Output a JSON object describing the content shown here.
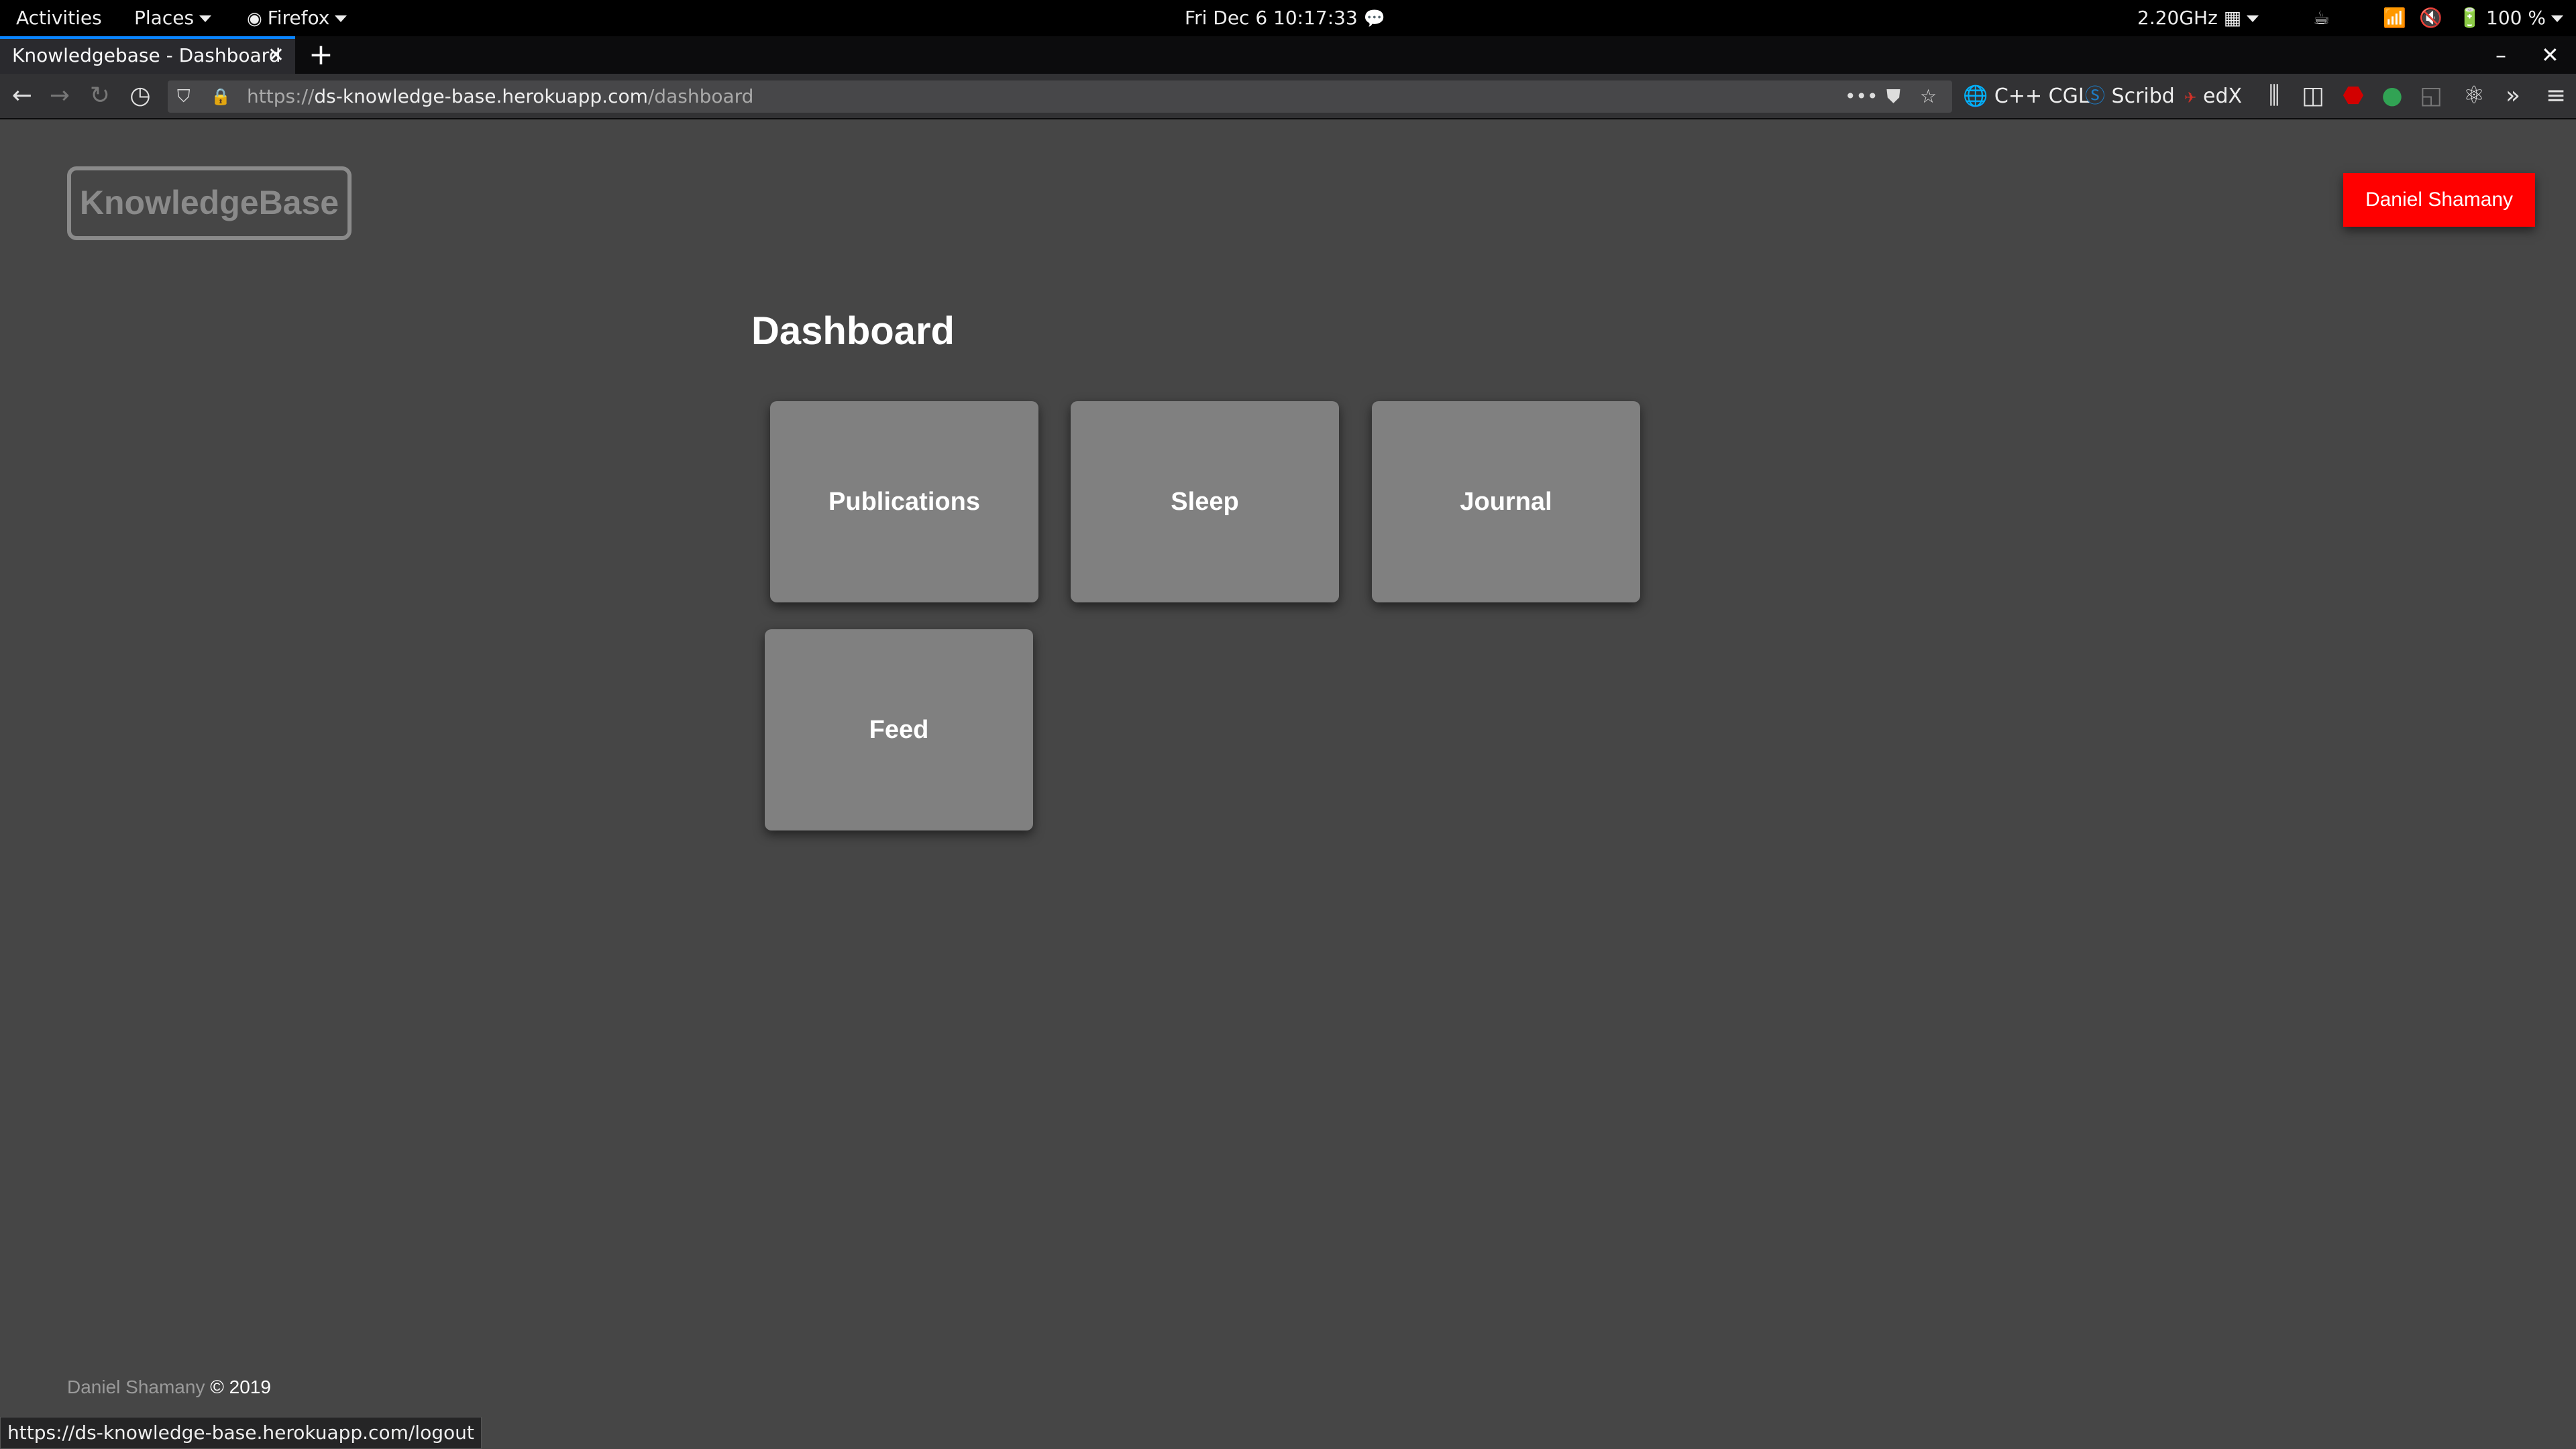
{
  "system_bar": {
    "activities": "Activities",
    "places": "Places",
    "firefox": "Firefox",
    "clock": "Fri Dec 6  10:17:33",
    "cpu": "2.20GHz",
    "battery": "100 %"
  },
  "browser": {
    "tab_title": "Knowledgebase - Dashboard",
    "url_proto": "https://",
    "url_host": "ds-knowledge-base.herokuapp.com",
    "url_path": "/dashboard",
    "bookmarks": [
      "C++ CGL",
      "Scribd",
      "edX"
    ],
    "status_url": "https://ds-knowledge-base.herokuapp.com/logout"
  },
  "page": {
    "logo": "KnowledgeBase",
    "user_button": "Daniel Shamany",
    "title": "Dashboard",
    "cards": [
      "Publications",
      "Sleep",
      "Journal",
      "Feed"
    ],
    "footer_name": "Daniel Shamany",
    "footer_copy": "© 2019"
  },
  "colors": {
    "page_bg": "#464646",
    "card_bg": "#808080",
    "user_button_bg": "#ff0000",
    "tab_accent": "#0a84ff"
  }
}
